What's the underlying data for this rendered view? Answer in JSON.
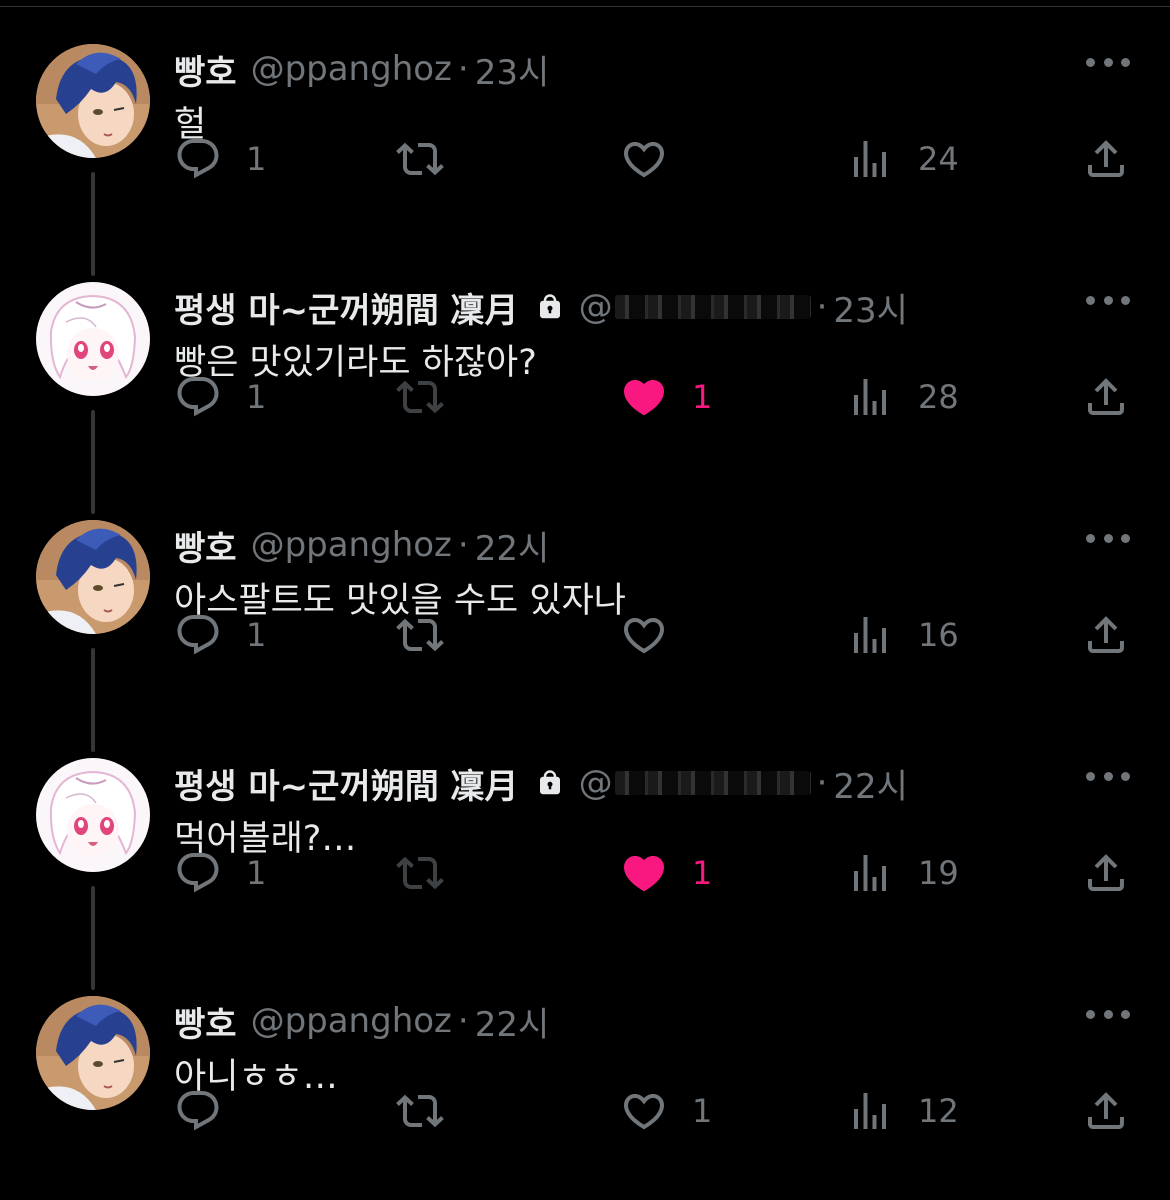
{
  "tweets": [
    {
      "author": "빵호",
      "handle": "@ppanghoz",
      "time": "23시",
      "text": "헐",
      "replies": "1",
      "retweets": "",
      "likes": "",
      "views": "24",
      "liked": false,
      "avatar": "blue-hair-avatar",
      "thread": true,
      "locked": false
    },
    {
      "author": "평생 마~군꺼朔間 凜月",
      "handle": "@",
      "time": "23시",
      "text": "빵은 맛있기라도 하잖아?",
      "replies": "1",
      "retweets": "",
      "likes": "1",
      "views": "28",
      "liked": true,
      "avatar": "pink-eyes-avatar",
      "thread": true,
      "locked": true
    },
    {
      "author": "빵호",
      "handle": "@ppanghoz",
      "time": "22시",
      "text": "아스팔트도 맛있을 수도 있자나",
      "replies": "1",
      "retweets": "",
      "likes": "",
      "views": "16",
      "liked": false,
      "avatar": "blue-hair-avatar",
      "thread": true,
      "locked": false
    },
    {
      "author": "평생 마~군꺼朔間 凜月",
      "handle": "@",
      "time": "22시",
      "text": "먹어볼래?…",
      "replies": "1",
      "retweets": "",
      "likes": "1",
      "views": "19",
      "liked": true,
      "avatar": "pink-eyes-avatar",
      "thread": true,
      "locked": true
    },
    {
      "author": "빵호",
      "handle": "@ppanghoz",
      "time": "22시",
      "text": "아니ㅎㅎ…",
      "replies": "",
      "retweets": "",
      "likes": "1",
      "views": "12",
      "liked": false,
      "avatar": "blue-hair-avatar",
      "thread": false,
      "locked": false
    }
  ],
  "dot_separator": "·",
  "colors": {
    "background": "#000000",
    "text": "#e7e9ea",
    "secondary": "#71767b",
    "like": "#f91880",
    "thread_line": "#333639"
  },
  "icons": [
    "reply-icon",
    "retweet-icon",
    "like-icon",
    "views-icon",
    "share-icon",
    "more-icon",
    "lock-icon"
  ]
}
